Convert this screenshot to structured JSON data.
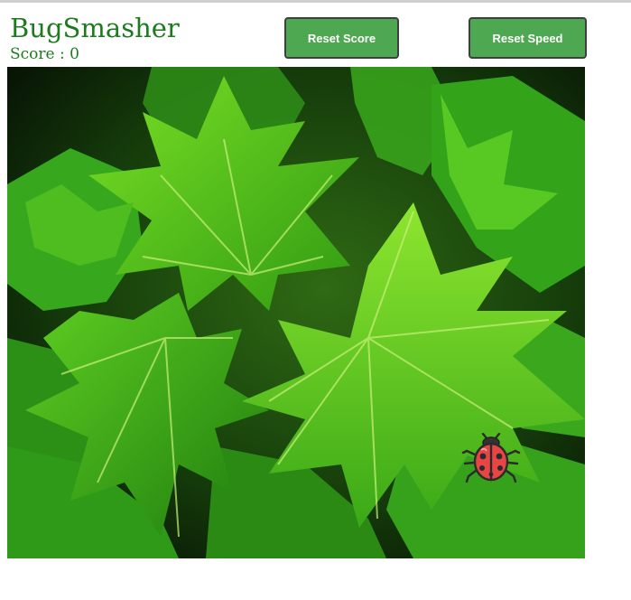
{
  "app": {
    "title": "BugSmasher",
    "score_text": "Score : 0"
  },
  "controls": {
    "reset_score_label": "Reset Score",
    "reset_speed_label": "Reset Speed"
  },
  "colors": {
    "title_green": "#1e7a1e",
    "button_green": "#4ea852",
    "button_border": "#3f3f3f",
    "bug_red": "#e84545"
  },
  "game": {
    "background_image": "green-leaves",
    "bug_icon": "ladybug-icon"
  }
}
